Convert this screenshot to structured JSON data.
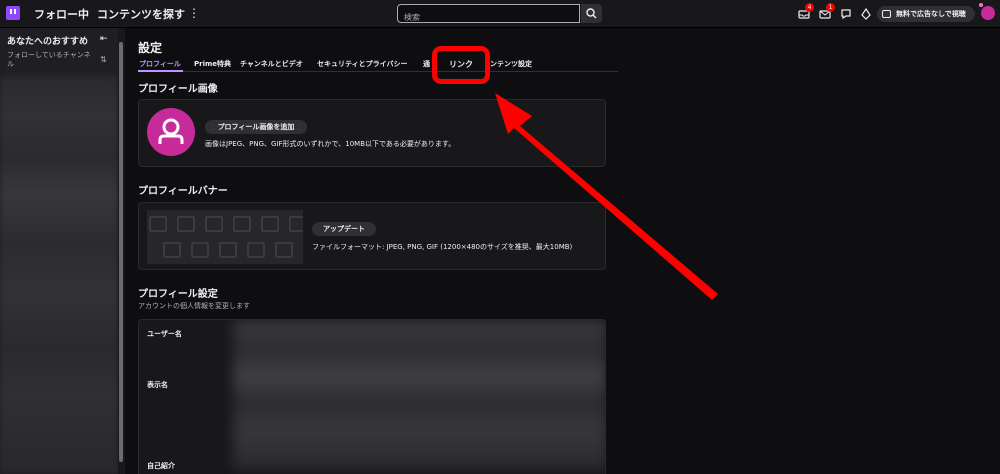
{
  "topbar": {
    "following": "フォロー中",
    "browse": "コンテンツを探す",
    "more": "⋮",
    "search_placeholder": "検索",
    "inbox_badge": "4",
    "whispers_badge": "1",
    "ad_free_label": "無料で広告なしで視聴"
  },
  "sidebar": {
    "title": "あなたへのおすすめ",
    "subtitle": "フォローしているチャンネル",
    "collapse_icon": "⇤",
    "sort_icon": "⇅"
  },
  "settings": {
    "title": "設定",
    "tabs": [
      {
        "label": "プロフィール",
        "active": true
      },
      {
        "label": "Prime特典"
      },
      {
        "label": "チャンネルとビデオ"
      },
      {
        "label": "セキュリティとプライバシー"
      },
      {
        "label": "通"
      },
      {
        "label": "ンテンツ設定"
      }
    ],
    "highlight_label": "リンク",
    "profile_image": {
      "title": "プロフィール画像",
      "button": "プロフィール画像を追加",
      "hint": "画像はJPEG、PNG、GIF形式のいずれかで、10MB以下である必要があります。"
    },
    "profile_banner": {
      "title": "プロフィールバナー",
      "button": "アップデート",
      "hint": "ファイルフォーマット: JPEG, PNG, GIF (1200×480のサイズを推奨、最大10MB)"
    },
    "profile_settings": {
      "title": "プロフィール設定",
      "subtitle": "アカウントの個人情報を変更します",
      "fields": [
        "ユーザー名",
        "表示名",
        "自己紹介"
      ]
    }
  },
  "colors": {
    "accent": "#bf94ff",
    "brand": "#9147ff",
    "annotation": "#ff0000",
    "avatar": "#c72b99"
  }
}
